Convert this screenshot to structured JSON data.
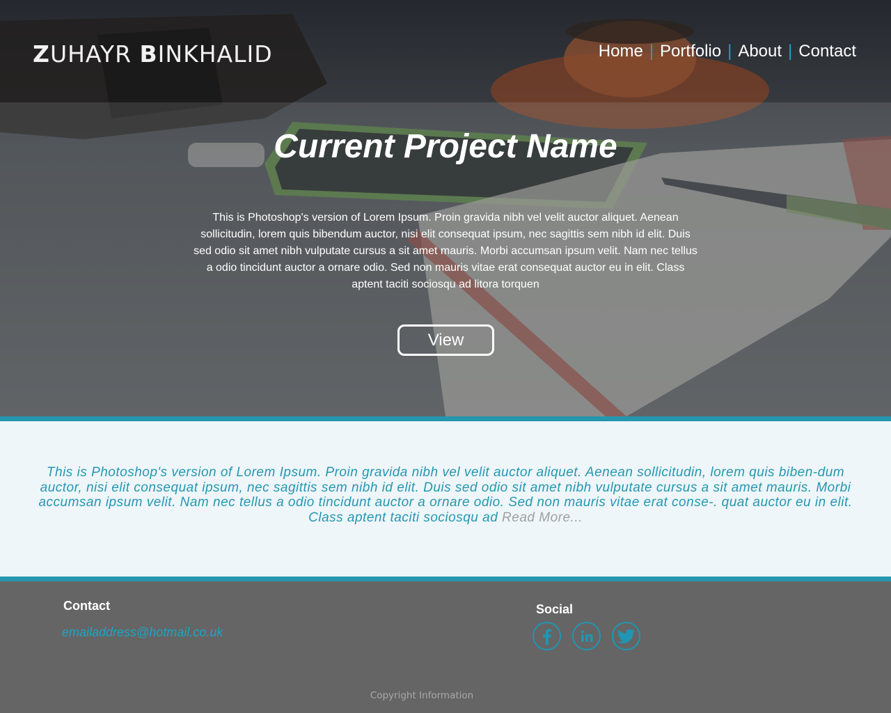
{
  "brand": {
    "first_initial": "Z",
    "first_rest": "UHAYR ",
    "last_initial": "B",
    "last_rest": "INKHALID"
  },
  "nav": {
    "items": [
      "Home",
      "Portfolio",
      "About",
      "Contact"
    ],
    "separator": "|"
  },
  "hero": {
    "title": "Current Project Name",
    "text": "This is Photoshop's version  of Lorem Ipsum. Proin gravida nibh vel velit auctor aliquet. Aenean sollicitudin, lorem quis bibendum auctor, nisi elit consequat ipsum, nec sagittis sem nibh id elit. Duis sed odio sit amet nibh vulputate cursus a sit amet mauris. Morbi accumsan ipsum velit. Nam nec tellus a odio tincidunt auctor a ornare odio. Sed non  mauris vitae erat consequat auctor eu in elit. Class aptent taciti sociosqu ad litora torquen",
    "button_label": "View"
  },
  "middle": {
    "text": "This is Photoshop's version  of Lorem Ipsum. Proin gravida nibh vel velit auctor aliquet. Aenean sollicitudin, lorem quis biben-dum auctor, nisi elit consequat ipsum, nec sagittis sem nibh id elit. Duis sed odio sit amet nibh vulputate cursus a sit amet mauris. Morbi accumsan ipsum velit. Nam nec tellus a odio tincidunt auctor a ornare odio. Sed non  mauris vitae erat conse-.  quat auctor eu in elit. Class aptent taciti sociosqu ad",
    "read_more": "Read More..."
  },
  "footer": {
    "contact_heading": "Contact",
    "email": "emailaddress@hotmail.co.uk",
    "social_heading": "Social",
    "social_icons": [
      "facebook-icon",
      "linkedin-icon",
      "twitter-icon"
    ],
    "copyright": "Copyright Information"
  },
  "colors": {
    "accent": "#2596ae",
    "middle_bg": "#eef6f9",
    "footer_bg": "#656565",
    "muted": "#a0a0a0"
  }
}
